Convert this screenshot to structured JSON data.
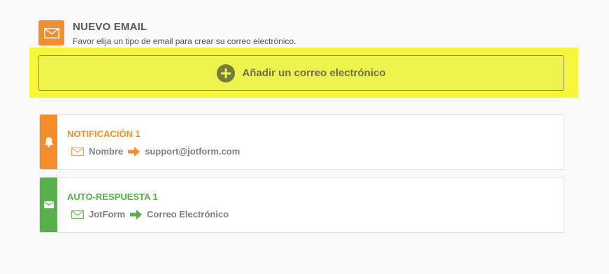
{
  "header": {
    "icon": "envelope-icon",
    "title": "NUEVO EMAIL",
    "subtitle": "Favor elija un tipo de email para crear su correo electrónico."
  },
  "add_button": {
    "icon": "plus-circle-icon",
    "label": "Añadir un correo electrónico"
  },
  "emails": [
    {
      "type_icon": "bell-icon",
      "title": "NOTIFICACIÓN 1",
      "from": "Nombre",
      "to": "support@jotform.com",
      "color": "#f28e2b"
    },
    {
      "type_icon": "envelope-icon",
      "title": "AUTO-RESPUESTA 1",
      "from": "JotForm",
      "to": "Correo Electrónico",
      "color": "#57b04a"
    }
  ],
  "colors": {
    "orange": "#f28e2b",
    "green": "#57b04a",
    "highlight": "#f7f73a"
  }
}
